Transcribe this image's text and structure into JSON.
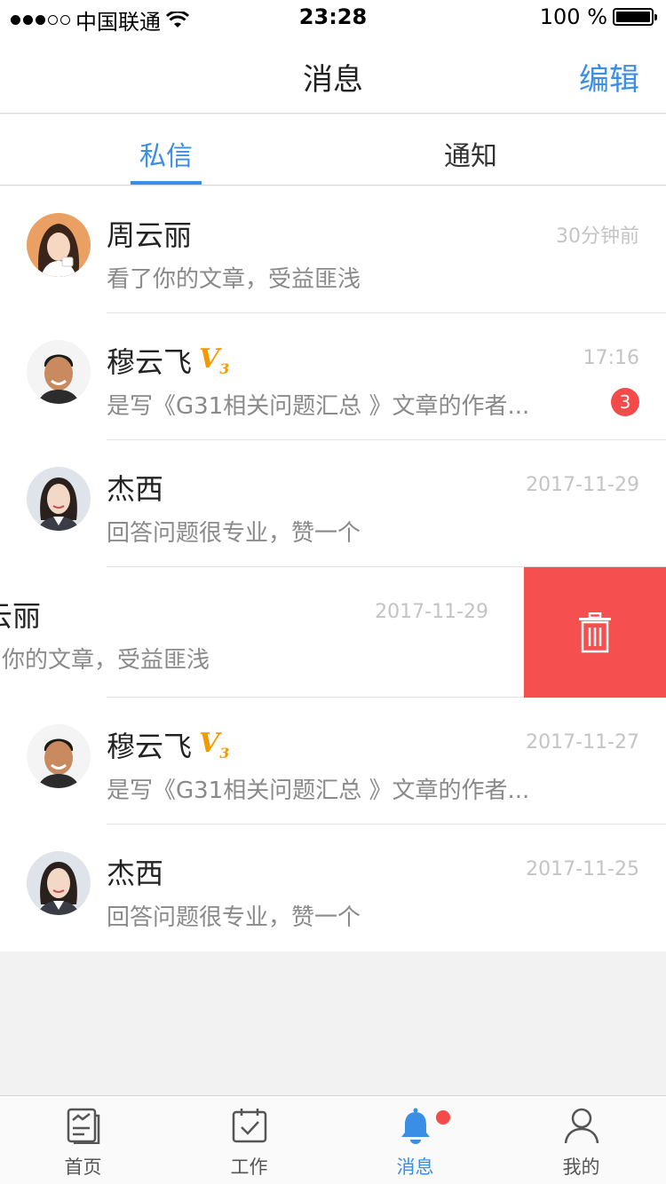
{
  "status_bar": {
    "carrier": "中国联通",
    "time": "23:28",
    "battery": "100 %",
    "signal_bars_filled": 3,
    "signal_bars_total": 5
  },
  "nav": {
    "title": "消息",
    "edit_label": "编辑"
  },
  "tabs": [
    {
      "label": "私信",
      "active": true
    },
    {
      "label": "通知",
      "active": false
    }
  ],
  "messages": [
    {
      "name": "周云丽",
      "preview": "看了你的文章，受益匪浅",
      "time": "30分钟前",
      "verified": false,
      "unread": null,
      "avatar": "woman-coffee"
    },
    {
      "name": "穆云飞",
      "preview": "是写《G31相关问题汇总 》文章的作者...",
      "time": "17:16",
      "verified": true,
      "unread": "3",
      "avatar": "man-smile"
    },
    {
      "name": "杰西",
      "preview": "回答问题很专业，赞一个",
      "time": "2017-11-29",
      "verified": false,
      "unread": null,
      "avatar": "woman-pro"
    },
    {
      "name": "周云丽",
      "preview": "看了你的文章，受益匪浅",
      "time": "2017-11-29",
      "verified": false,
      "unread": null,
      "avatar": "woman-coffee",
      "swiped": true
    },
    {
      "name": "穆云飞",
      "preview": "是写《G31相关问题汇总 》文章的作者...",
      "time": "2017-11-27",
      "verified": true,
      "unread": null,
      "avatar": "man-smile"
    },
    {
      "name": "杰西",
      "preview": "回答问题很专业，赞一个",
      "time": "2017-11-25",
      "verified": false,
      "unread": null,
      "avatar": "woman-pro"
    }
  ],
  "verified_badge": {
    "letter": "V",
    "level": "3",
    "color": "#f29a00"
  },
  "delete_action": {
    "icon": "trash-icon",
    "color": "#f5504f"
  },
  "tab_bar": [
    {
      "label": "首页",
      "icon": "home-document-icon",
      "active": false
    },
    {
      "label": "工作",
      "icon": "calendar-check-icon",
      "active": false
    },
    {
      "label": "消息",
      "icon": "bell-icon",
      "active": true,
      "has_dot": true
    },
    {
      "label": "我的",
      "icon": "person-icon",
      "active": false
    }
  ],
  "colors": {
    "accent": "#3a8ee6",
    "badge": "#f44a4a",
    "delete": "#f5504f",
    "vip": "#f29a00"
  }
}
